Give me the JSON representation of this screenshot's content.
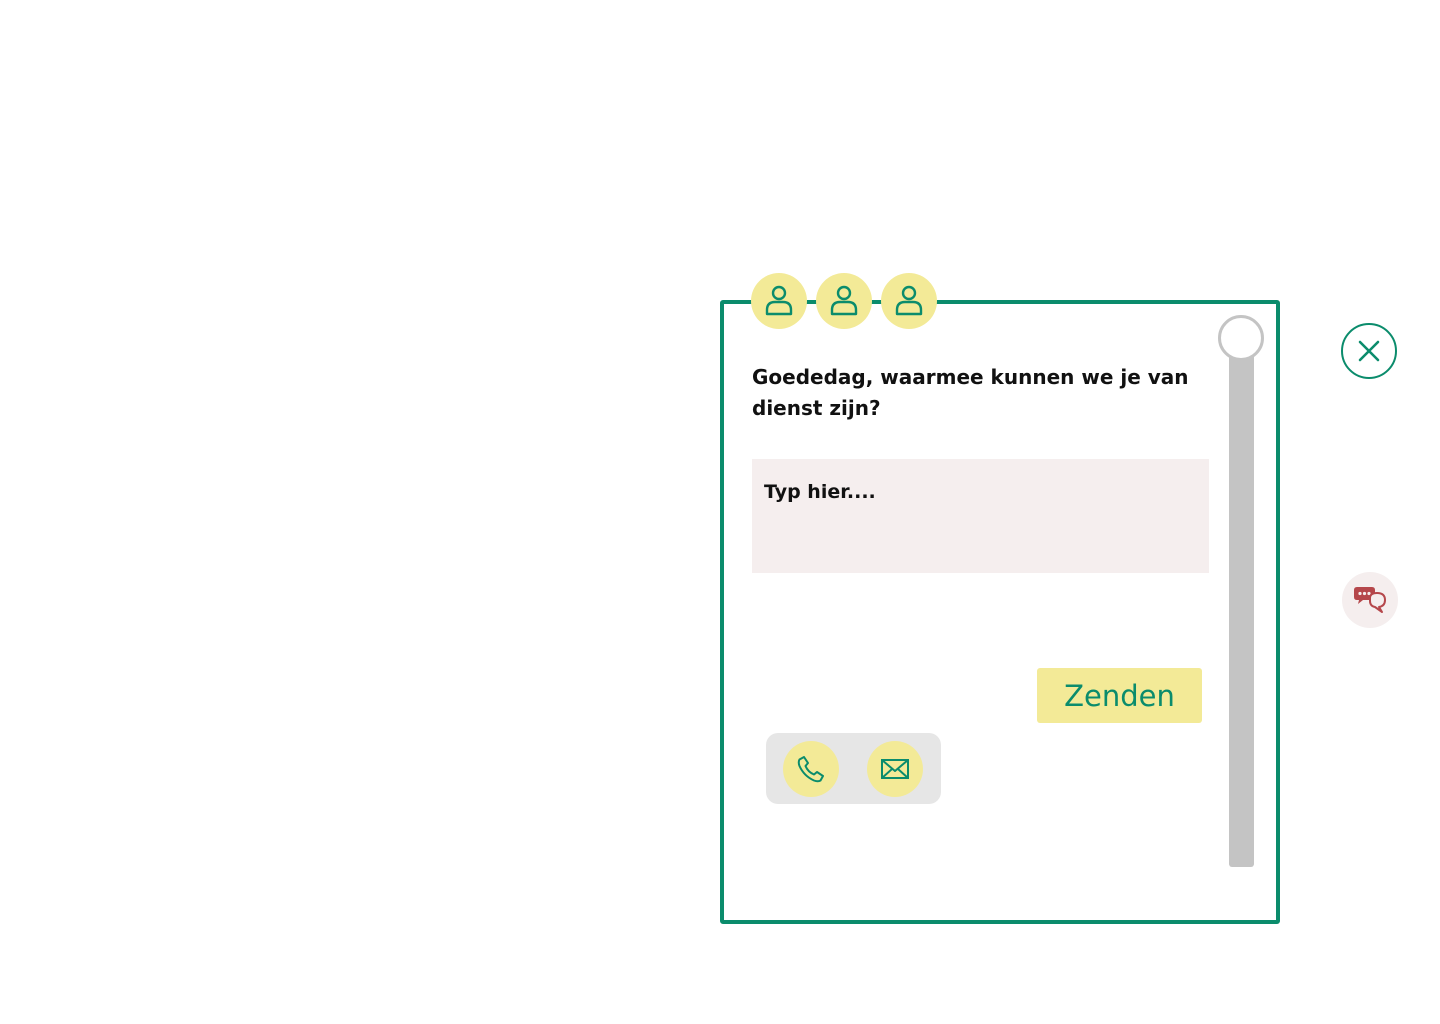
{
  "chat": {
    "greeting": "Goededag, waarmee kunnen we je van dienst zijn?",
    "input_placeholder": "Typ hier....",
    "send_label": "Zenden",
    "agents": [
      {
        "icon": "user-icon"
      },
      {
        "icon": "user-icon"
      },
      {
        "icon": "user-icon"
      }
    ],
    "contact_options": [
      {
        "icon": "phone-icon"
      },
      {
        "icon": "mail-icon"
      }
    ]
  },
  "controls": {
    "close_icon": "close-icon",
    "launcher_icon": "chat-bubbles-icon"
  },
  "colors": {
    "brand_green": "#0b8c6c",
    "accent_yellow": "#f3ea97",
    "input_background": "#f5eeee",
    "launcher_icon_red": "#b5474b",
    "scrollbar_grey": "#c4c4c4",
    "tray_grey": "#e6e6e6"
  }
}
